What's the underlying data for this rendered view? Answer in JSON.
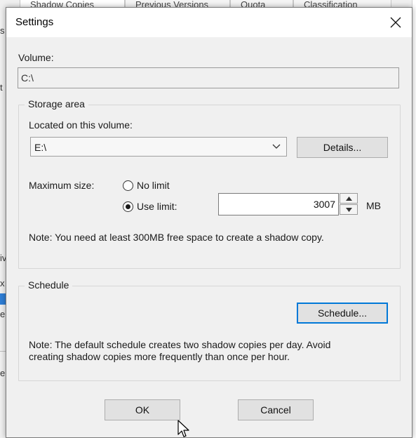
{
  "background": {
    "tabs": [
      "Shadow Copies",
      "Previous Versions",
      "Quota",
      "Classification"
    ],
    "fragments": [
      "s",
      "t",
      "iv",
      "x",
      "e",
      "e"
    ]
  },
  "dialog": {
    "title": "Settings",
    "volume_label": "Volume:",
    "volume_value": "C:\\",
    "storage": {
      "group_title": "Storage area",
      "located_label": "Located on this volume:",
      "drive_value": "E:\\",
      "details_button": "Details...",
      "max_size_label": "Maximum size:",
      "no_limit_label": "No limit",
      "use_limit_label": "Use limit:",
      "selected_option": "use_limit",
      "limit_value": "3007",
      "unit": "MB",
      "note": "Note: You need at least 300MB free space to create a shadow copy."
    },
    "schedule": {
      "group_title": "Schedule",
      "schedule_button": "Schedule...",
      "note_line1": "Note: The default schedule creates two shadow copies per day. Avoid",
      "note_line2": "creating shadow copies more frequently than once per hour."
    },
    "ok_button": "OK",
    "cancel_button": "Cancel"
  },
  "icons": {
    "close": "close-icon",
    "dropdown": "chevron-down-icon",
    "spin_up": "spin-up-icon",
    "spin_down": "spin-down-icon",
    "cursor": "mouse-pointer-icon"
  },
  "colors": {
    "focus_accent": "#0078d7",
    "dialog_bg": "#f0f0f0",
    "selection_blue": "#2f7fd6"
  }
}
